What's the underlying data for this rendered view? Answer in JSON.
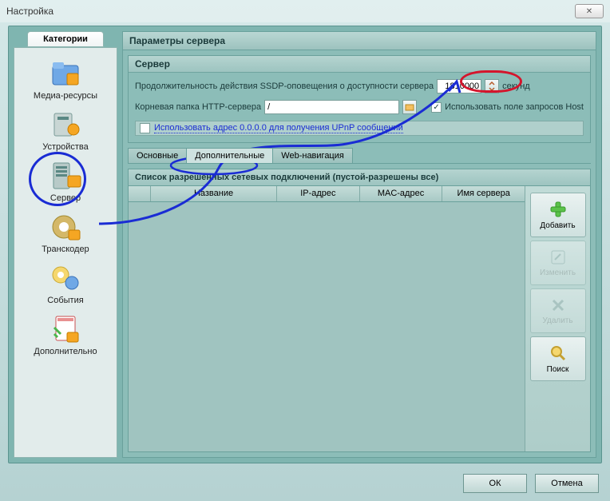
{
  "window": {
    "title": "Настройка"
  },
  "sidebar": {
    "tab": "Категории",
    "items": [
      {
        "label": "Медиа-ресурсы"
      },
      {
        "label": "Устройства"
      },
      {
        "label": "Сервер"
      },
      {
        "label": "Транскодер"
      },
      {
        "label": "События"
      },
      {
        "label": "Дополнительно"
      }
    ]
  },
  "main": {
    "title": "Параметры сервера",
    "server_group": "Сервер",
    "ssdp_label": "Продолжительность действия SSDP-оповещения о доступности сервера",
    "ssdp_value": "1810000",
    "ssdp_unit": "секунд",
    "root_label": "Корневая папка HTTP-сервера",
    "root_value": "/",
    "host_checkbox": "Использовать поле запросов Host",
    "host_checked": true,
    "upnp_checkbox": "Использовать адрес 0.0.0.0 для получения UPnP сообщений",
    "upnp_checked": false,
    "tabs": [
      {
        "label": "Основные"
      },
      {
        "label": "Дополнительные",
        "active": true
      },
      {
        "label": "Web-навигация"
      }
    ],
    "conn_title": "Список разрешенных сетевых подключений (пустой-разрешены все)",
    "columns": {
      "name": "Название",
      "ip": "IP-адрес",
      "mac": "MAC-адрес",
      "server": "Имя сервера"
    },
    "actions": {
      "add": "Добавить",
      "edit": "Изменить",
      "delete": "Удалить",
      "search": "Поиск"
    }
  },
  "buttons": {
    "ok": "ОК",
    "cancel": "Отмена"
  }
}
